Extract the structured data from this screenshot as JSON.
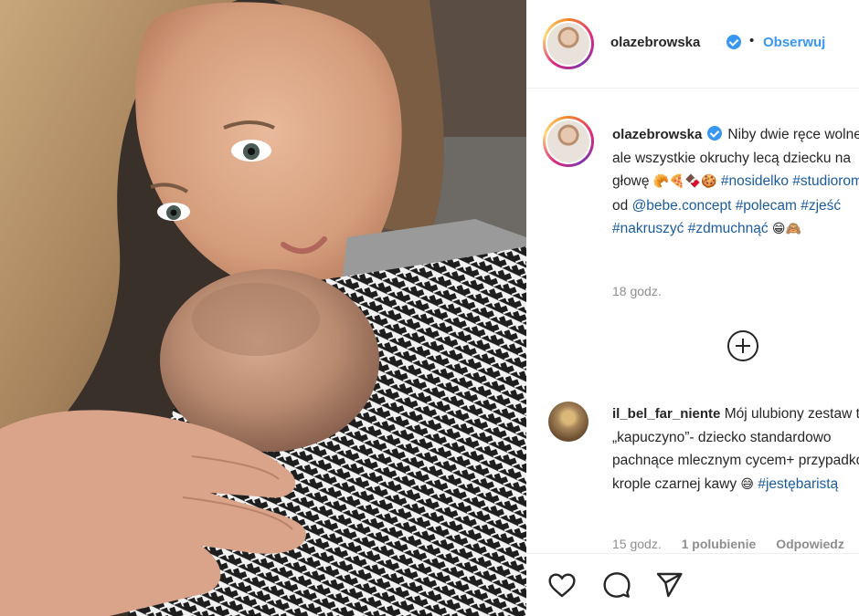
{
  "post": {
    "author": "olazebrowska",
    "follow_label": "Obserwuj",
    "separator": "•"
  },
  "caption": {
    "author": "olazebrowska",
    "text_1": "Niby dwie ręce wolne, ale wszystkie okruchy lecą dziecku na głowę",
    "emojis": "🥐🍕🍫🍪",
    "tags_1": "#nosidelko #studioromeo",
    "text_2": "od",
    "mention": "@bebe.concept",
    "tags_2": "#polecam #zjeść #nakruszyć #zdmuchnąć",
    "emojis_2": "😁🙈",
    "time": "18 godz."
  },
  "comment": {
    "author": "il_bel_far_niente",
    "text": "Mój ulubiony zestaw to „kapuczyno”- dziecko standardowo pachnące mlecznym cycem+ przypadkowe krople czarnej kawy",
    "emoji": "😅",
    "tag": "#jestębaristą",
    "time": "15 godz.",
    "likes": "1 polubienie",
    "reply": "Odpowiedz"
  },
  "icons": {
    "like": "heart-icon",
    "comment": "comment-icon",
    "share": "paper-plane-icon",
    "load_more": "plus-circle-icon",
    "verified": "verified-badge-icon"
  },
  "colors": {
    "link_blue": "#3897f0",
    "hashtag": "#1a5b9e",
    "muted": "#8e8e8e"
  }
}
